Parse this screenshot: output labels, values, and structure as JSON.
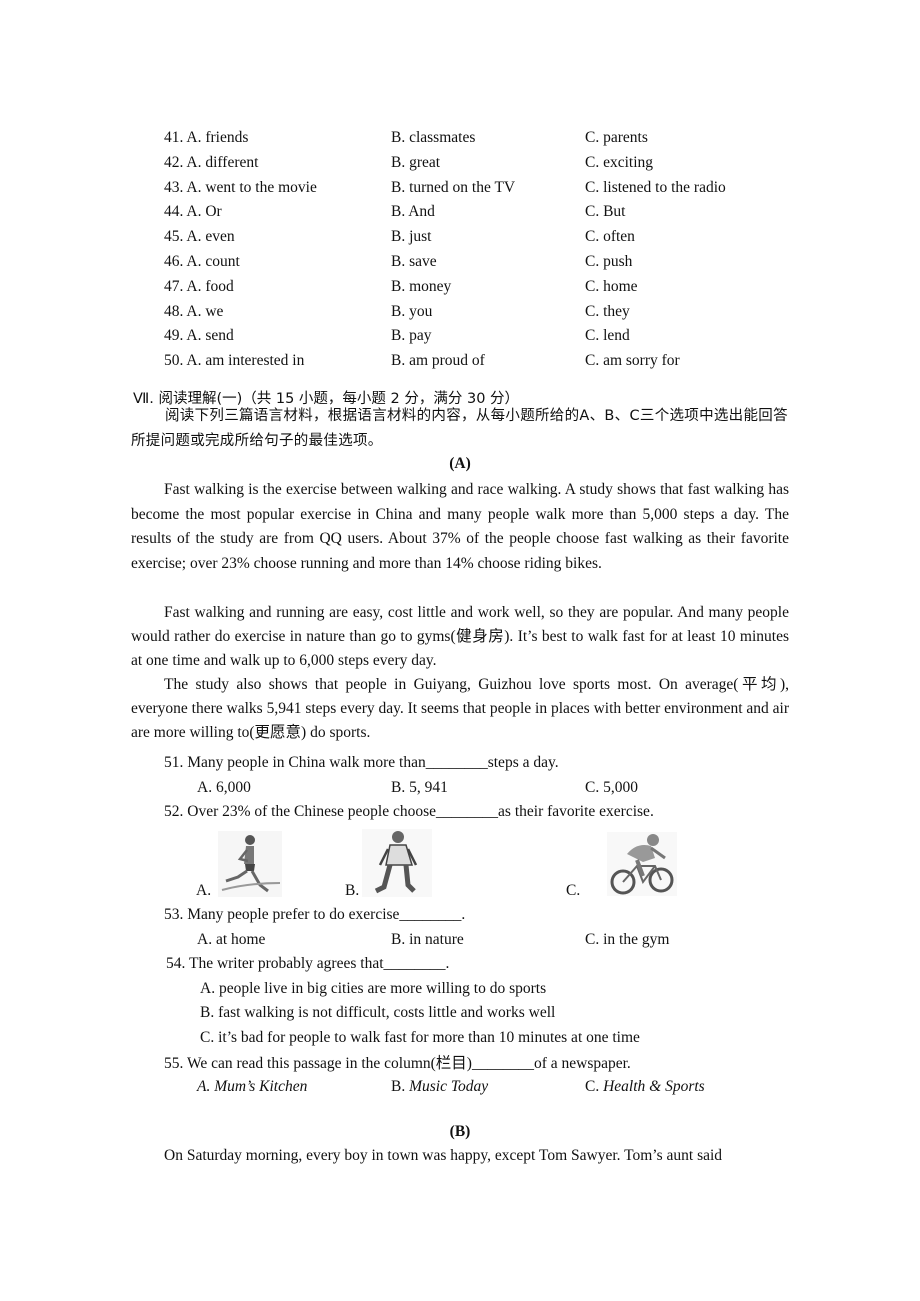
{
  "cloze_options": [
    {
      "num": "41.",
      "a": "A. friends",
      "b": "B. classmates",
      "c": "C. parents"
    },
    {
      "num": "42.",
      "a": "A. different",
      "b": "B. great",
      "c": "C. exciting"
    },
    {
      "num": "43.",
      "a": "A. went to the movie",
      "b": "B. turned on the TV",
      "c": "C. listened to the radio"
    },
    {
      "num": "44.",
      "a": "A. Or",
      "b": "B. And",
      "c": "C. But"
    },
    {
      "num": "45.",
      "a": "A. even",
      "b": "B. just",
      "c": "C. often"
    },
    {
      "num": "46.",
      "a": "A. count",
      "b": "B. save",
      "c": "C. push"
    },
    {
      "num": "47.",
      "a": "A. food",
      "b": "B. money",
      "c": "C. home"
    },
    {
      "num": "48.",
      "a": "A. we",
      "b": "B. you",
      "c": "C. they"
    },
    {
      "num": "49.",
      "a": "A. send",
      "b": "B. pay",
      "c": "C. lend"
    },
    {
      "num": "50.",
      "a": "A. am interested in",
      "b": "B. am proud of",
      "c": "C. am sorry for"
    }
  ],
  "section": {
    "title": "Ⅶ. 阅读理解(一)（共 15 小题，每小题 2 分，满分 30 分）",
    "instructions": "阅读下列三篇语言材料，根据语言材料的内容，从每小题所给的A、B、C三个选项中选出能回答所提问题或完成所给句子的最佳选项。"
  },
  "passage_a": {
    "heading": "(A)",
    "paragraphs": [
      "Fast walking is the exercise between walking and race walking. A study shows that fast walking has become the most popular exercise in China and many people walk more than 5,000 steps a day. The results of the study are from QQ users. About 37% of the people choose fast walking as their favorite exercise; over 23% choose running and more than 14% choose riding bikes.",
      "Fast walking and running are easy, cost little and work well, so they are popular. And many people would rather do exercise in nature than go to gyms(健身房). It’s best to walk fast for at least 10 minutes at one time and walk up to 6,000 steps every day.",
      "The study also shows that people in Guiyang, Guizhou love sports most. On average(平均), everyone there walks 5,941 steps every day. It seems that people in places with better environment and air are more willing to(更愿意) do sports."
    ]
  },
  "questions": {
    "q51": {
      "stem": "51. Many people in China walk more than________steps a day.",
      "a": "A. 6,000",
      "b": "B. 5, 941",
      "c": "C. 5,000"
    },
    "q52": {
      "stem": "52. Over 23% of the Chinese people choose________as their favorite exercise.",
      "a": "A.",
      "b": "B.",
      "c": "C.",
      "images": [
        "running-boy-picture",
        "walking-man-picture",
        "cyclist-picture"
      ]
    },
    "q53": {
      "stem": "53. Many people prefer to do exercise________.",
      "a": "A. at home",
      "b": "B. in nature",
      "c": "C. in the gym"
    },
    "q54": {
      "stem": "54. The writer probably agrees that________.",
      "a": "A. people live in big cities are more willing to do sports",
      "b": "B. fast walking is not difficult, costs little and works well",
      "c": "C. it’s bad for people to walk fast for more than 10 minutes at one time"
    },
    "q55": {
      "stem": "55. We can read this passage in the column(栏目)________of a newspaper.",
      "a": "A. Mum’s Kitchen",
      "b_prefix": "B. ",
      "b": "Music Today",
      "c_prefix": "C. ",
      "c": "Health & Sports"
    }
  },
  "passage_b": {
    "heading": "(B)",
    "first_line": "On Saturday morning, every boy in town was happy, except Tom Sawyer. Tom’s aunt said"
  }
}
